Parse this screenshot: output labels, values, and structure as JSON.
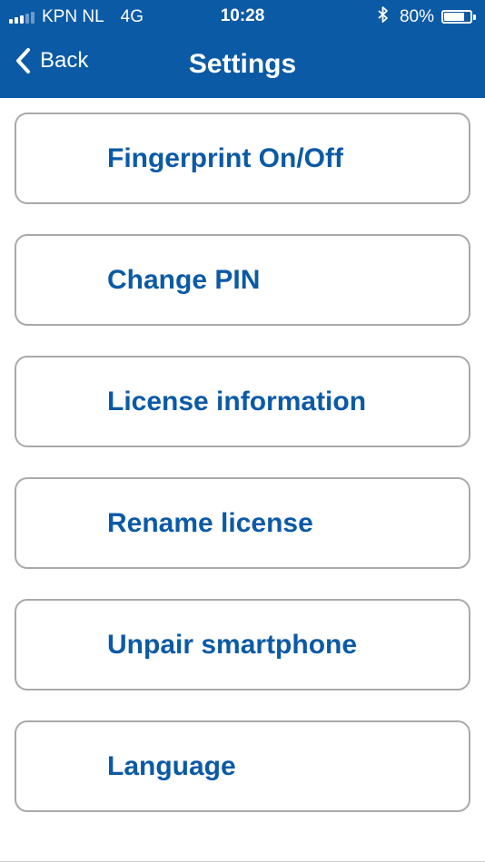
{
  "status_bar": {
    "carrier": "KPN NL",
    "network": "4G",
    "time": "10:28",
    "battery_percent_label": "80%",
    "battery_level": 0.8,
    "signal_bars_filled": 3,
    "signal_bars_total": 5,
    "icons": [
      "signal-icon",
      "bluetooth-icon",
      "battery-icon"
    ]
  },
  "nav": {
    "back_label": "Back",
    "title": "Settings"
  },
  "menu": {
    "items": [
      {
        "label": "Fingerprint On/Off"
      },
      {
        "label": "Change PIN"
      },
      {
        "label": "License information"
      },
      {
        "label": "Rename license"
      },
      {
        "label": "Unpair smartphone"
      },
      {
        "label": "Language"
      }
    ]
  },
  "colors": {
    "brand_blue": "#0b5aa6",
    "button_border": "#a9a9a9",
    "background": "#ffffff"
  }
}
